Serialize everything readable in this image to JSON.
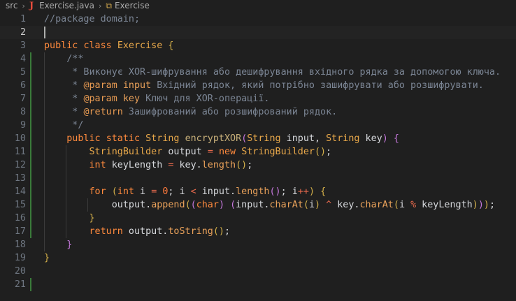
{
  "breadcrumb": {
    "folder": "src",
    "file": "Exercise.java",
    "symbol": "Exercise",
    "file_icon": "J"
  },
  "editor": {
    "active_line": 2,
    "lines": [
      {
        "n": "1",
        "parts": [
          [
            "com",
            "//package domain;"
          ]
        ]
      },
      {
        "n": "2",
        "parts": []
      },
      {
        "n": "3",
        "parts": [
          [
            "kw",
            "public"
          ],
          [
            "plain",
            " "
          ],
          [
            "kw",
            "class"
          ],
          [
            "plain",
            " "
          ],
          [
            "cls",
            "Exercise"
          ],
          [
            "plain",
            " "
          ],
          [
            "paren",
            "{"
          ]
        ]
      },
      {
        "n": "4",
        "indent": 1,
        "parts": [
          [
            "com",
            "    /**"
          ]
        ]
      },
      {
        "n": "5",
        "indent": 1,
        "parts": [
          [
            "com",
            "     * Виконує XOR-шифрування або дешифрування вхідного рядка за допомогою ключа."
          ]
        ]
      },
      {
        "n": "6",
        "indent": 1,
        "parts": [
          [
            "com",
            "     * "
          ],
          [
            "tag",
            "@param"
          ],
          [
            "com",
            " "
          ],
          [
            "mth",
            "input"
          ],
          [
            "com",
            " Вхідний рядок, який потрібно зашифрувати або розшифрувати."
          ]
        ]
      },
      {
        "n": "7",
        "indent": 1,
        "parts": [
          [
            "com",
            "     * "
          ],
          [
            "tag",
            "@param"
          ],
          [
            "com",
            " "
          ],
          [
            "mth",
            "key"
          ],
          [
            "com",
            " Ключ для XOR-операції."
          ]
        ]
      },
      {
        "n": "8",
        "indent": 1,
        "parts": [
          [
            "com",
            "     * "
          ],
          [
            "tag",
            "@return"
          ],
          [
            "com",
            " Зашифрований або розшифрований рядок."
          ]
        ]
      },
      {
        "n": "9",
        "indent": 1,
        "parts": [
          [
            "com",
            "     */"
          ]
        ]
      },
      {
        "n": "10",
        "indent": 1,
        "parts": [
          [
            "plain",
            "    "
          ],
          [
            "kw",
            "public"
          ],
          [
            "plain",
            " "
          ],
          [
            "kw",
            "static"
          ],
          [
            "plain",
            " "
          ],
          [
            "cls",
            "String"
          ],
          [
            "plain",
            " "
          ],
          [
            "fn",
            "encryptXOR"
          ],
          [
            "paren2",
            "("
          ],
          [
            "cls",
            "String"
          ],
          [
            "plain",
            " input, "
          ],
          [
            "cls",
            "String"
          ],
          [
            "plain",
            " key"
          ],
          [
            "paren2",
            ")"
          ],
          [
            "plain",
            " "
          ],
          [
            "paren2",
            "{"
          ]
        ]
      },
      {
        "n": "11",
        "indent": 2,
        "parts": [
          [
            "plain",
            "        "
          ],
          [
            "cls",
            "StringBuilder"
          ],
          [
            "plain",
            " output "
          ],
          [
            "op",
            "="
          ],
          [
            "plain",
            " "
          ],
          [
            "kw",
            "new"
          ],
          [
            "plain",
            " "
          ],
          [
            "cls",
            "StringBuilder"
          ],
          [
            "paren",
            "()"
          ],
          [
            "plain",
            ";"
          ]
        ]
      },
      {
        "n": "12",
        "indent": 2,
        "parts": [
          [
            "plain",
            "        "
          ],
          [
            "kw",
            "int"
          ],
          [
            "plain",
            " keyLength "
          ],
          [
            "op",
            "="
          ],
          [
            "plain",
            " key."
          ],
          [
            "mth",
            "length"
          ],
          [
            "paren",
            "()"
          ],
          [
            "plain",
            ";"
          ]
        ]
      },
      {
        "n": "13",
        "indent": 2,
        "parts": []
      },
      {
        "n": "14",
        "indent": 2,
        "parts": [
          [
            "plain",
            "        "
          ],
          [
            "kw",
            "for"
          ],
          [
            "plain",
            " "
          ],
          [
            "paren",
            "("
          ],
          [
            "kw",
            "int"
          ],
          [
            "plain",
            " i "
          ],
          [
            "op",
            "="
          ],
          [
            "plain",
            " "
          ],
          [
            "num",
            "0"
          ],
          [
            "plain",
            "; i "
          ],
          [
            "op",
            "<"
          ],
          [
            "plain",
            " input."
          ],
          [
            "mth",
            "length"
          ],
          [
            "paren2",
            "()"
          ],
          [
            "plain",
            "; i"
          ],
          [
            "op",
            "++"
          ],
          [
            "paren",
            ")"
          ],
          [
            "plain",
            " "
          ],
          [
            "paren",
            "{"
          ]
        ]
      },
      {
        "n": "15",
        "indent": 3,
        "parts": [
          [
            "plain",
            "            output."
          ],
          [
            "mth",
            "append"
          ],
          [
            "paren",
            "("
          ],
          [
            "paren2",
            "("
          ],
          [
            "kw",
            "char"
          ],
          [
            "paren2",
            ")"
          ],
          [
            "plain",
            " "
          ],
          [
            "paren2",
            "("
          ],
          [
            "plain",
            "input."
          ],
          [
            "mth",
            "charAt"
          ],
          [
            "paren",
            "("
          ],
          [
            "plain",
            "i"
          ],
          [
            "paren",
            ")"
          ],
          [
            "plain",
            " "
          ],
          [
            "op",
            "^"
          ],
          [
            "plain",
            " key."
          ],
          [
            "mth",
            "charAt"
          ],
          [
            "paren",
            "("
          ],
          [
            "plain",
            "i "
          ],
          [
            "op",
            "%"
          ],
          [
            "plain",
            " keyLength"
          ],
          [
            "paren",
            ")"
          ],
          [
            "paren2",
            ")"
          ],
          [
            "paren",
            ")"
          ],
          [
            "plain",
            ";"
          ]
        ]
      },
      {
        "n": "16",
        "indent": 2,
        "parts": [
          [
            "plain",
            "        "
          ],
          [
            "paren",
            "}"
          ]
        ]
      },
      {
        "n": "17",
        "indent": 2,
        "parts": [
          [
            "plain",
            "        "
          ],
          [
            "kw",
            "return"
          ],
          [
            "plain",
            " output."
          ],
          [
            "mth",
            "toString"
          ],
          [
            "paren",
            "()"
          ],
          [
            "plain",
            ";"
          ]
        ]
      },
      {
        "n": "18",
        "indent": 1,
        "parts": [
          [
            "plain",
            "    "
          ],
          [
            "paren2",
            "}"
          ]
        ]
      },
      {
        "n": "19",
        "parts": [
          [
            "paren",
            "}"
          ]
        ]
      },
      {
        "n": "20",
        "parts": []
      },
      {
        "n": "21",
        "parts": []
      }
    ]
  },
  "colors": {
    "background": "#1f1f1f",
    "keyword": "#ff8a3d",
    "comment": "#7b8594",
    "type": "#e8a84a"
  }
}
